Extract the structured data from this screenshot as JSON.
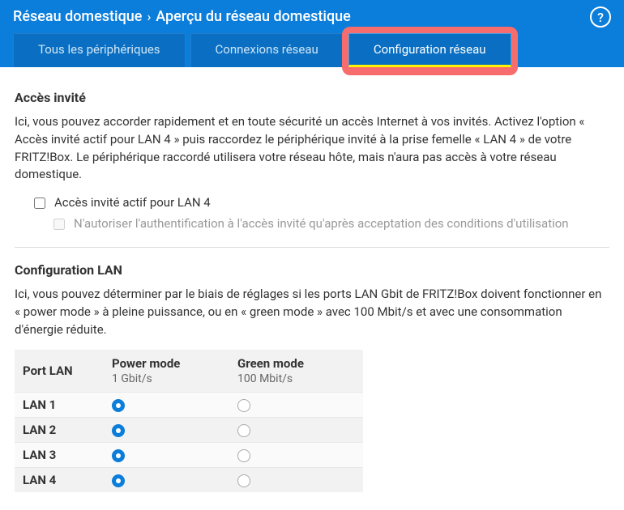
{
  "breadcrumb": {
    "parent": "Réseau domestique",
    "current": "Aperçu du réseau domestique"
  },
  "tabs": {
    "all_devices": "Tous les périphériques",
    "network_connections": "Connexions réseau",
    "network_config": "Configuration réseau"
  },
  "guest_access": {
    "title": "Accès invité",
    "text": "Ici, vous pouvez accorder rapidement et en toute sécurité un accès Internet à vos invités. Activez l'option « Accès invité actif pour LAN 4 » puis raccordez le périphérique invité à la prise femelle « LAN 4 » de votre FRITZ!Box. Le périphérique raccordé utilisera votre réseau hôte, mais n'aura pas accès à votre réseau domestique.",
    "checkbox1": "Accès invité actif pour LAN 4",
    "checkbox2": "N'autoriser l'authentification à l'accès invité qu'après acceptation des conditions d'utilisation"
  },
  "lan_config": {
    "title": "Configuration LAN",
    "text": "Ici, vous pouvez déterminer par le biais de réglages si les ports LAN Gbit de FRITZ!Box doivent fonctionner en « power mode » à pleine puissance, ou en « green mode » avec 100 Mbit/s et avec une consommation d'énergie réduite.",
    "headers": {
      "port": "Port LAN",
      "power": "Power mode",
      "power_sub": "1 Gbit/s",
      "green": "Green mode",
      "green_sub": "100 Mbit/s"
    },
    "rows": [
      {
        "port": "LAN 1",
        "power": true,
        "green": false
      },
      {
        "port": "LAN 2",
        "power": true,
        "green": false
      },
      {
        "port": "LAN 3",
        "power": true,
        "green": false
      },
      {
        "port": "LAN 4",
        "power": true,
        "green": false
      }
    ]
  },
  "help_glyph": "?"
}
